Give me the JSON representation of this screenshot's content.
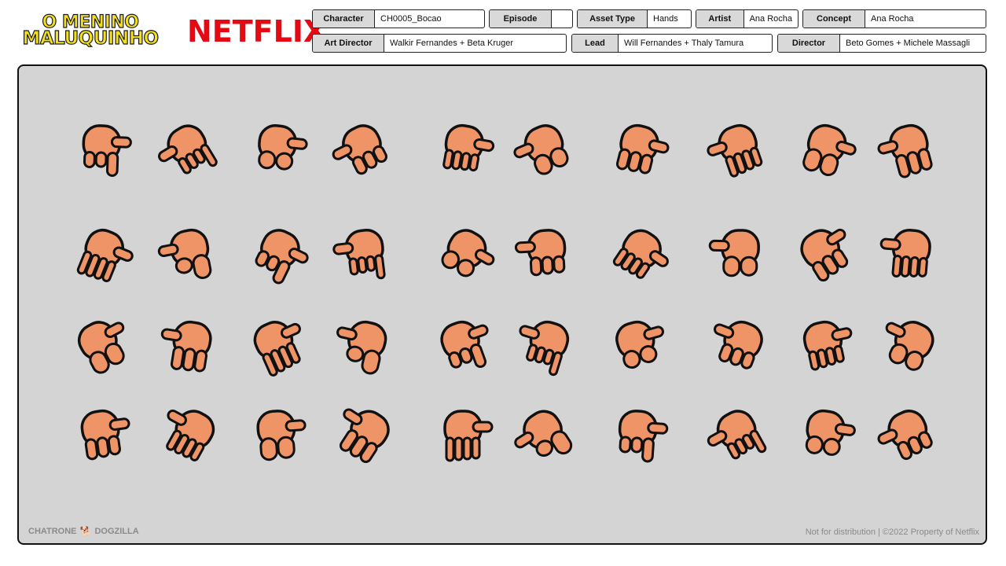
{
  "logos": {
    "show_line1": "O MENINO",
    "show_line2": "MALUQUINHO",
    "network": "NETFLIX"
  },
  "fields": [
    {
      "label": "Character",
      "value": "CH0005_Bocao"
    },
    {
      "label": "Episode",
      "value": ""
    },
    {
      "label": "Asset Type",
      "value": "Hands"
    },
    {
      "label": "Artist",
      "value": "Ana Rocha"
    },
    {
      "label": "Concept",
      "value": "Ana Rocha"
    },
    {
      "label": "Art Director",
      "value": "Walkir Fernandes + Beta Kruger"
    },
    {
      "label": "Lead",
      "value": "Will Fernandes + Thaly Tamura"
    },
    {
      "label": "Director",
      "value": "Beto Gomes + Michele Massagli"
    }
  ],
  "sheet": {
    "hands_per_row": [
      10,
      10,
      10,
      10
    ],
    "skin_color": "#ef9466",
    "outline_color": "#111111",
    "background_color": "#d4d4d4"
  },
  "footer": {
    "studio1": "CHATRONE",
    "studio2": "DOGZILLA",
    "notice": "Not for distribution | ©2022 Property of Netflix"
  }
}
